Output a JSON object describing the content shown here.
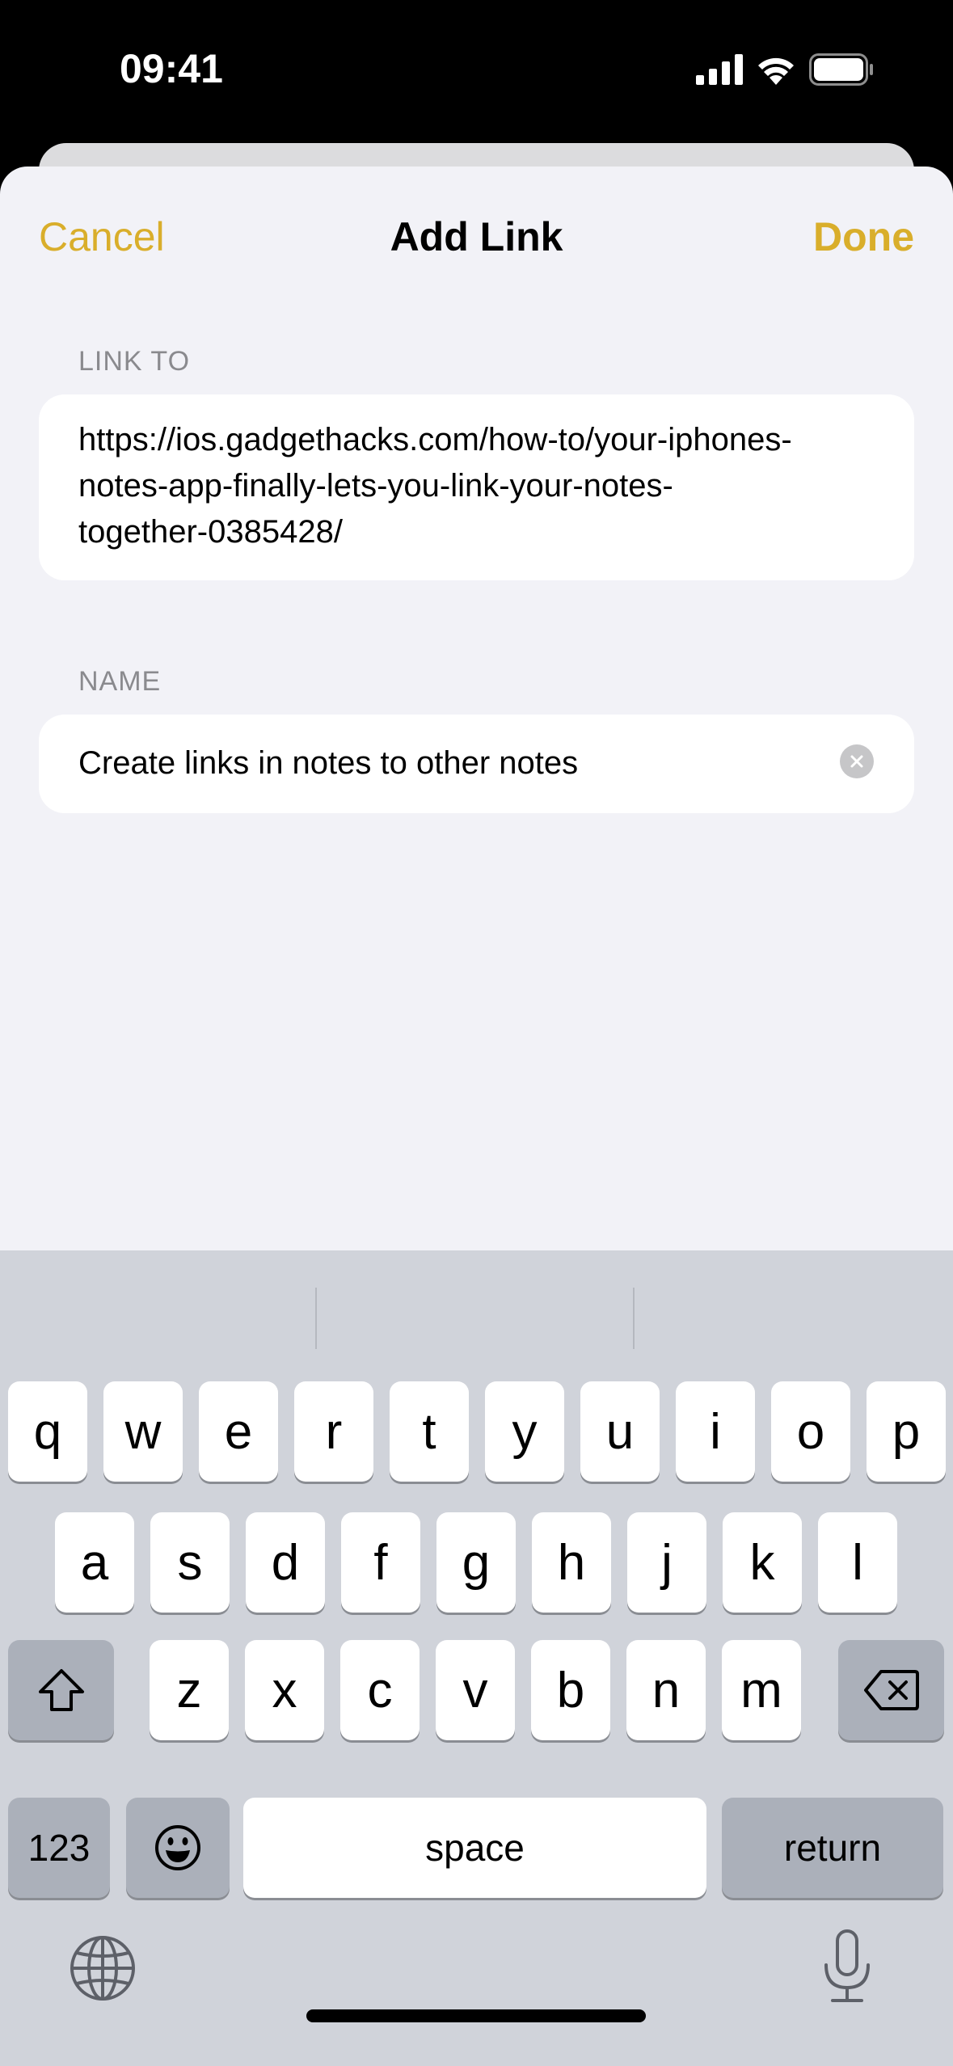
{
  "status_bar": {
    "time": "09:41",
    "icons": [
      "signal-icon",
      "wifi-icon",
      "battery-icon"
    ]
  },
  "nav": {
    "cancel_label": "Cancel",
    "title": "Add Link",
    "done_label": "Done",
    "accent_color": "#d9ae2b"
  },
  "link_to": {
    "label": "LINK TO",
    "value": "https://ios.gadgethacks.com/how-to/your-iphones-notes-app-finally-lets-you-link-your-notes-together-0385428/",
    "lines": [
      "https://ios.gadgethacks.com/how-to/your-iphones-",
      "notes-app-finally-lets-you-link-your-notes-",
      "together-0385428/"
    ]
  },
  "name": {
    "label": "NAME",
    "value": "Create links in notes to other notes",
    "clear_icon": "clear-circle-icon"
  },
  "keyboard": {
    "row1": [
      "q",
      "w",
      "e",
      "r",
      "t",
      "y",
      "u",
      "i",
      "o",
      "p"
    ],
    "row2": [
      "a",
      "s",
      "d",
      "f",
      "g",
      "h",
      "j",
      "k",
      "l"
    ],
    "row3": [
      "z",
      "x",
      "c",
      "v",
      "b",
      "n",
      "m"
    ],
    "shift_icon": "shift-icon",
    "delete_icon": "delete-icon",
    "numbers_label": "123",
    "emoji_icon": "emoji-icon",
    "space_label": "space",
    "return_label": "return",
    "globe_icon": "globe-icon",
    "mic_icon": "microphone-icon"
  }
}
